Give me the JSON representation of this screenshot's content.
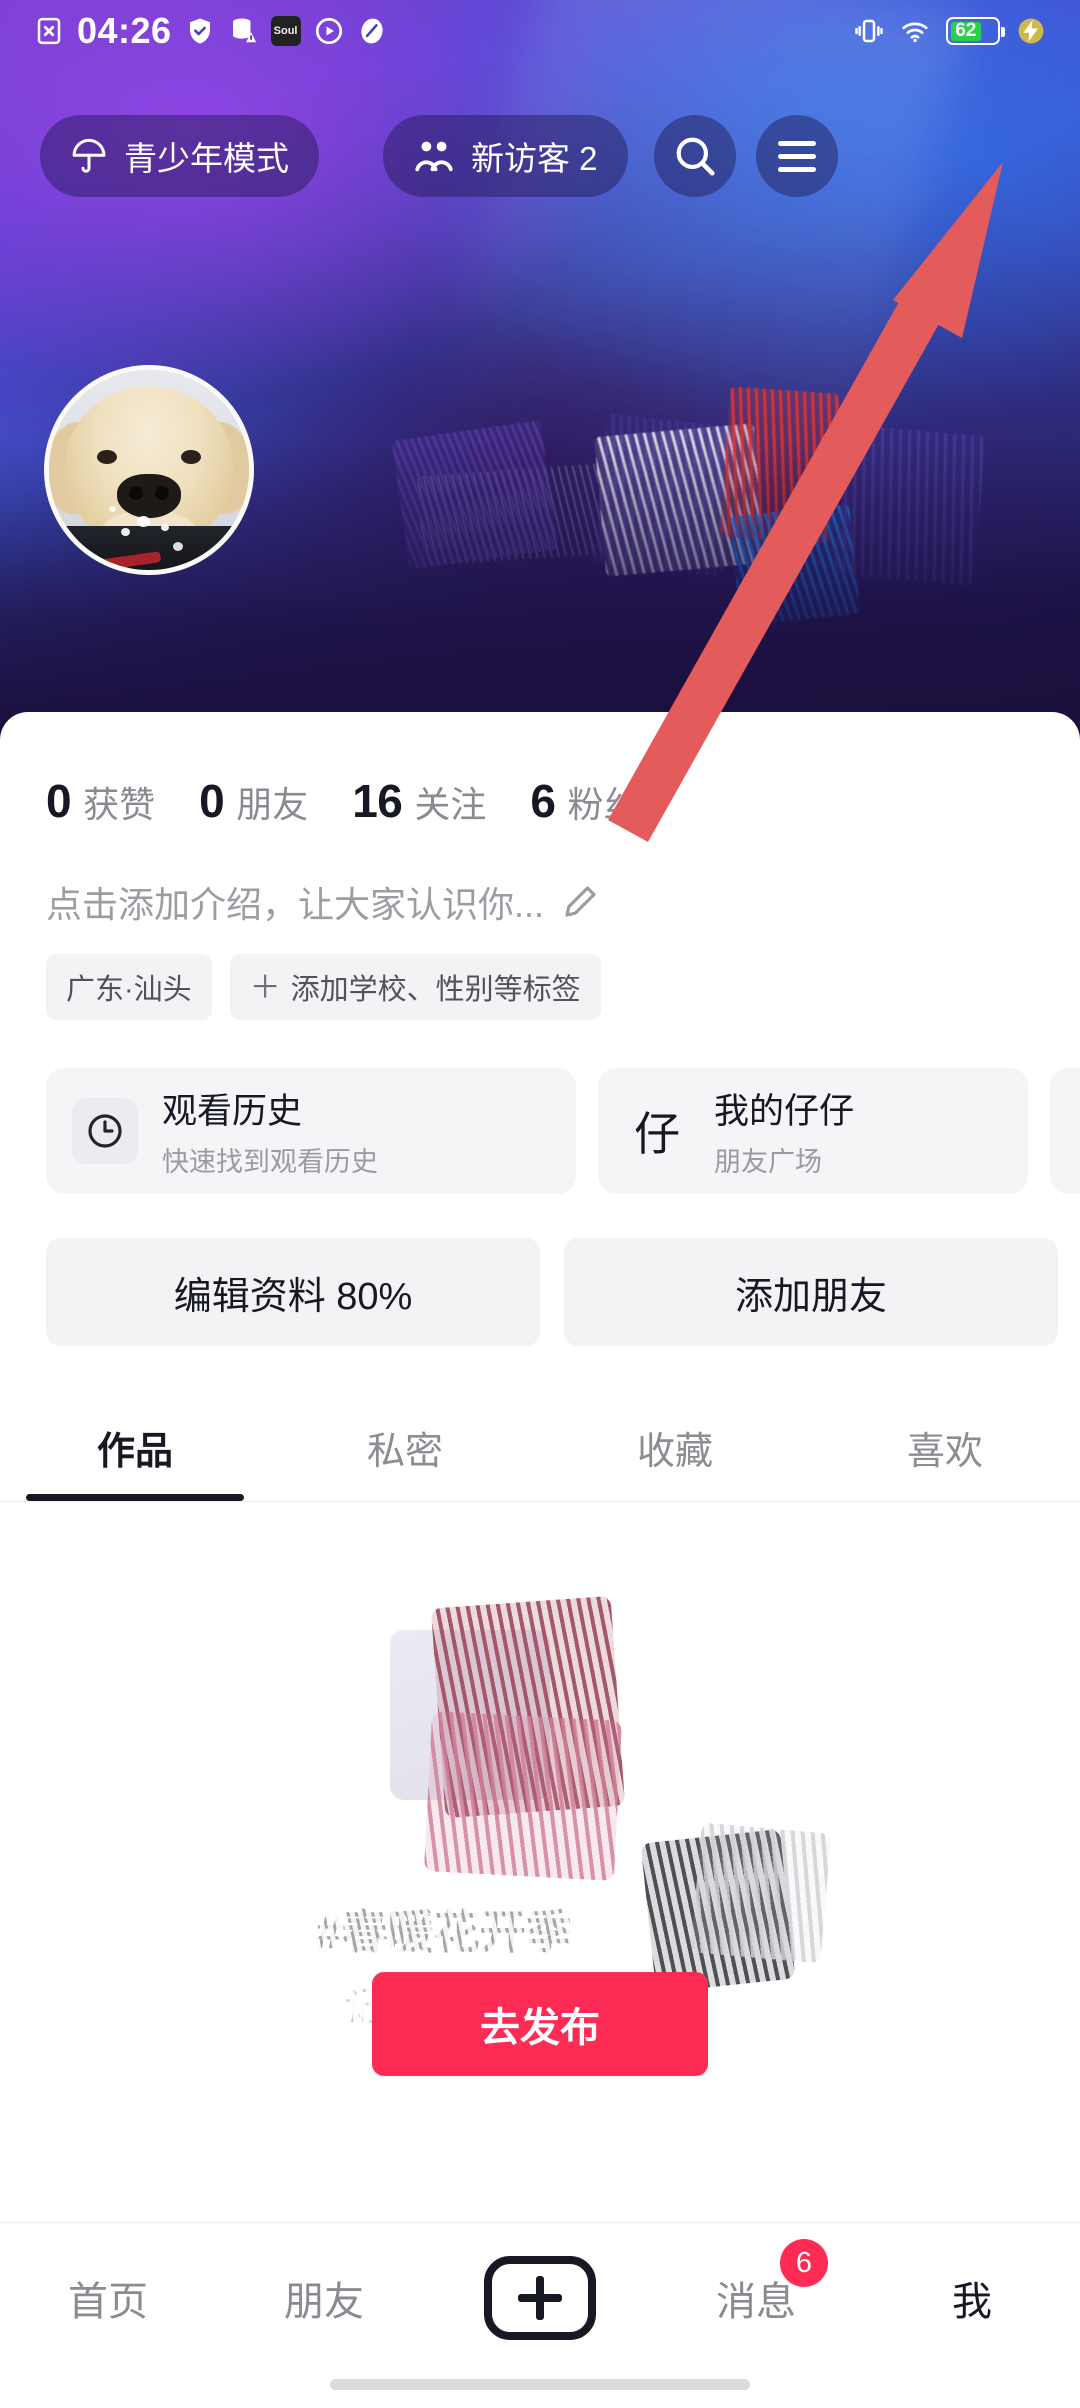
{
  "status_bar": {
    "time": "04:26",
    "battery_percent": "62",
    "left_icons": [
      "sim-error-icon",
      "shield-check-icon",
      "database-warning-icon",
      "soul-app-icon",
      "play-circle-icon",
      "compass-icon"
    ],
    "right_icons": [
      "vibrate-icon",
      "wifi-icon",
      "battery-icon",
      "charging-bolt-icon"
    ],
    "app_icon_label": "Soul"
  },
  "top_nav": {
    "teen_mode_label": "青少年模式",
    "visitor_label": "新访客 2",
    "search_icon": "search-icon",
    "menu_icon": "hamburger-menu-icon"
  },
  "profile": {
    "avatar": "golden-retriever-avatar",
    "stats": [
      {
        "count": "0",
        "label": "获赞"
      },
      {
        "count": "0",
        "label": "朋友"
      },
      {
        "count": "16",
        "label": "关注"
      },
      {
        "count": "6",
        "label": "粉丝"
      }
    ],
    "bio_placeholder": "点击添加介绍，让大家认识你...",
    "edit_bio_icon": "pencil-icon",
    "tags": [
      {
        "label": "广东·汕头",
        "has_plus": false
      },
      {
        "label": "添加学校、性别等标签",
        "has_plus": true
      }
    ]
  },
  "entry_cards": [
    {
      "title": "观看历史",
      "subtitle": "快速找到观看历史",
      "icon": "clock-icon"
    },
    {
      "title": "我的仔仔",
      "subtitle": "朋友广场",
      "icon": "zai-character-icon"
    },
    {
      "title": "",
      "subtitle": "",
      "icon": "book-icon"
    }
  ],
  "actions": {
    "edit_profile_label": "编辑资料 80%",
    "add_friend_label": "添加朋友"
  },
  "content_tabs": [
    {
      "label": "作品",
      "active": true
    },
    {
      "label": "私密",
      "active": false
    },
    {
      "label": "收藏",
      "active": false
    },
    {
      "label": "喜欢",
      "active": false
    }
  ],
  "empty_state": {
    "illustration_title": "#春暖花开季",
    "illustration_subtitle": "记录春天的美好景象",
    "publish_label": "去发布"
  },
  "bottom_nav": [
    {
      "label": "首页",
      "active": false,
      "badge": ""
    },
    {
      "label": "朋友",
      "active": false,
      "badge": ""
    },
    {
      "label": "",
      "active": false,
      "badge": "",
      "icon": "plus-create-icon"
    },
    {
      "label": "消息",
      "active": false,
      "badge": "6"
    },
    {
      "label": "我",
      "active": true,
      "badge": ""
    }
  ],
  "annotation": {
    "arrow_color": "#e45b5b",
    "points_to": "hamburger-menu-icon"
  },
  "colors": {
    "accent_red": "#fe2c55",
    "text_primary": "#161823",
    "text_secondary": "#8a8b91",
    "chip_bg": "#f3f3f5",
    "battery_green": "#2ad04a"
  }
}
